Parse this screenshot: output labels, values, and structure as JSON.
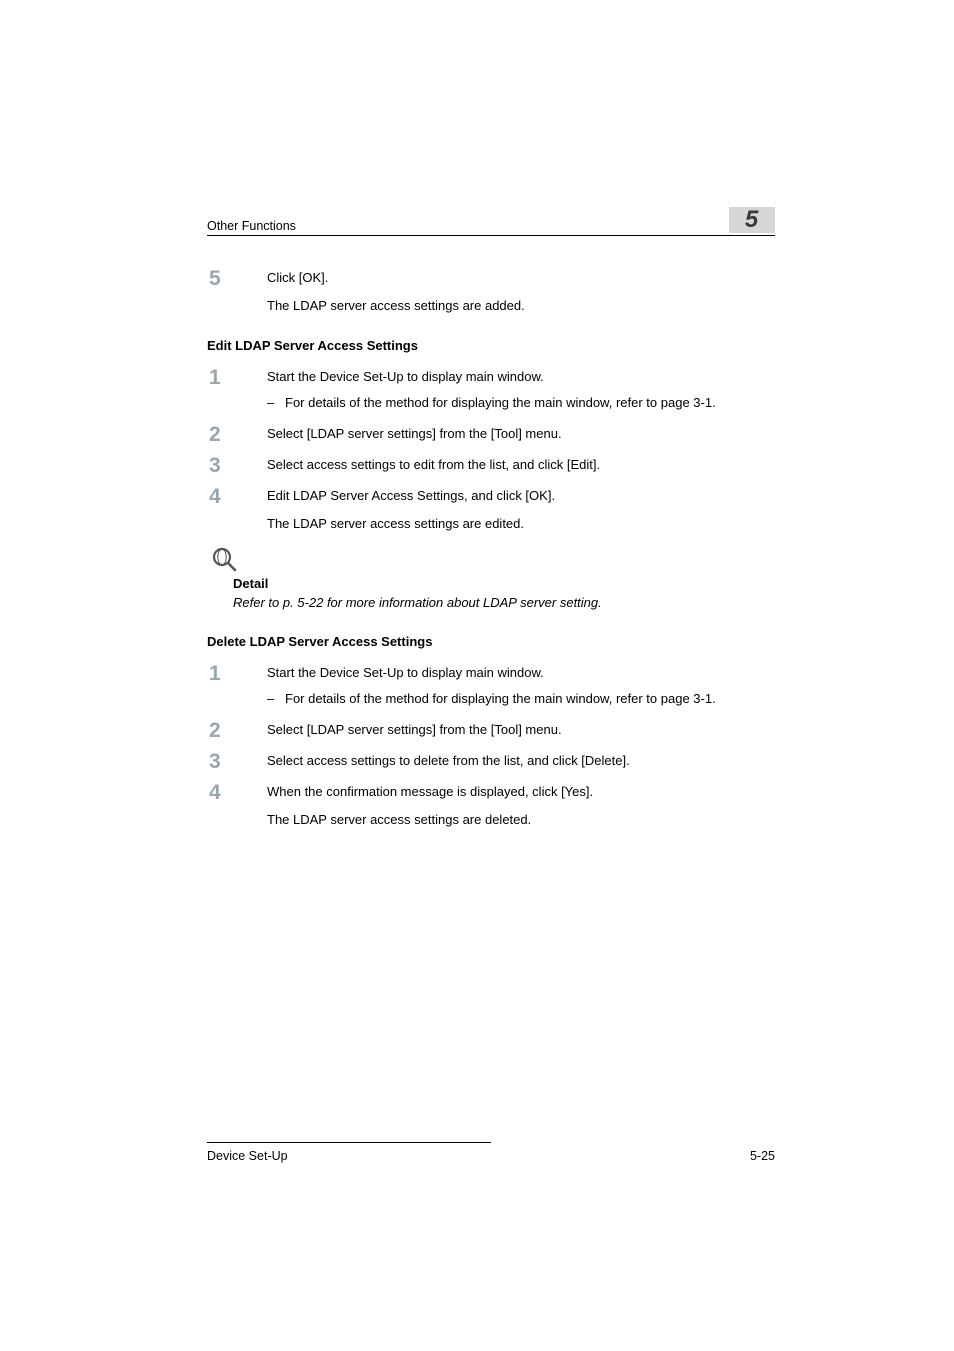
{
  "header": {
    "section_title": "Other Functions",
    "chapter_number": "5"
  },
  "intro_step": {
    "number": "5",
    "line1": "Click [OK].",
    "line2": "The LDAP server access settings are added."
  },
  "edit_section": {
    "heading": "Edit LDAP Server Access Settings",
    "steps": [
      {
        "number": "1",
        "text": "Start the Device Set-Up to display main window.",
        "sub": "For details of the method for displaying the main window, refer to page 3-1."
      },
      {
        "number": "2",
        "text": "Select [LDAP server settings] from the [Tool] menu."
      },
      {
        "number": "3",
        "text": "Select access settings to edit from the list, and click [Edit]."
      },
      {
        "number": "4",
        "text": "Edit LDAP Server Access Settings, and click [OK].",
        "text2": "The LDAP server access settings are edited."
      }
    ],
    "detail": {
      "label": "Detail",
      "text": "Refer to p. 5-22 for more information about LDAP server setting."
    }
  },
  "delete_section": {
    "heading": "Delete LDAP Server Access Settings",
    "steps": [
      {
        "number": "1",
        "text": "Start the Device Set-Up to display main window.",
        "sub": "For details of the method for displaying the main window, refer to page 3-1."
      },
      {
        "number": "2",
        "text": "Select [LDAP server settings] from the [Tool] menu."
      },
      {
        "number": "3",
        "text": "Select access settings to delete from the list, and click [Delete]."
      },
      {
        "number": "4",
        "text": "When the confirmation message is displayed, click [Yes].",
        "text2": "The LDAP server access settings are deleted."
      }
    ]
  },
  "footer": {
    "doc_title": "Device Set-Up",
    "page_number": "5-25"
  }
}
